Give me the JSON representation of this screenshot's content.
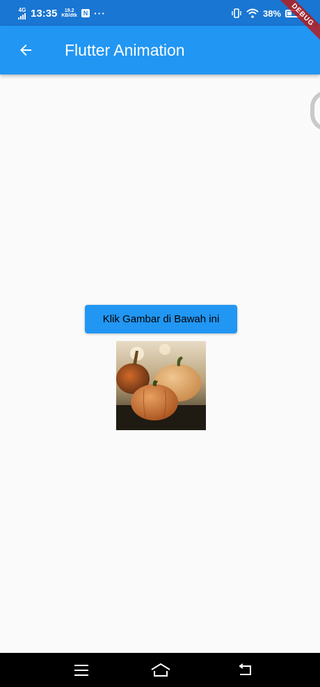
{
  "status_bar": {
    "network": "4G",
    "time": "13:35",
    "speed_value": "19.2",
    "speed_unit": "KB/dtk",
    "app_icon_label": "N",
    "more": "···",
    "battery": "38%",
    "battery_level": 0.38,
    "icons": [
      "signal-icon",
      "vibrate-icon",
      "wifi-icon",
      "battery-icon"
    ]
  },
  "app_bar": {
    "title": "Flutter Animation",
    "back_icon": "arrow-left-icon",
    "background": "#2196f3"
  },
  "debug_banner": "DEBUG",
  "main": {
    "button_label": "Klik Gambar di Bawah ini",
    "button_color": "#2196f3",
    "image": "pumpkins-photo"
  },
  "nav_bar": {
    "buttons": [
      "menu-icon",
      "home-icon",
      "back-icon"
    ]
  }
}
